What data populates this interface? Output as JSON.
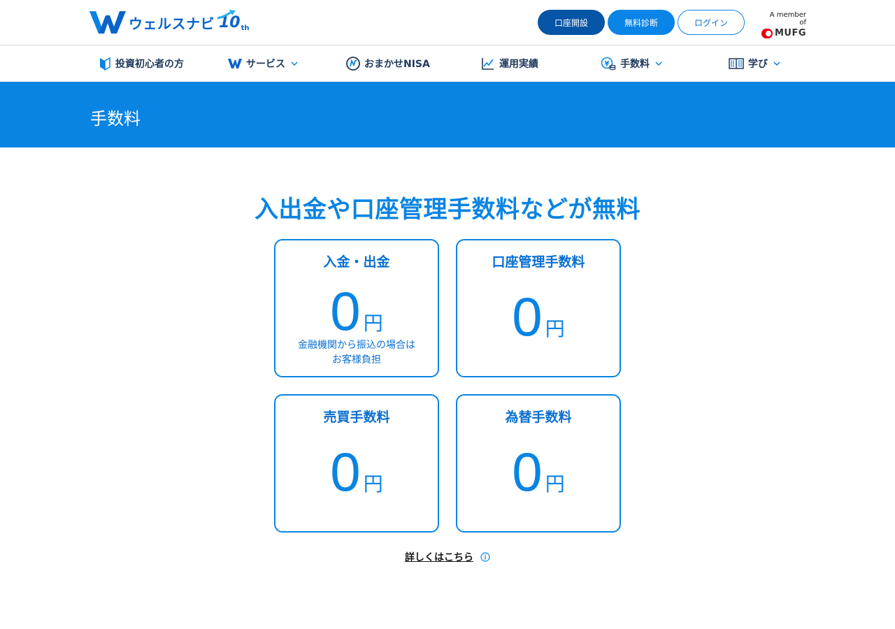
{
  "header": {
    "logo_text": "ウェルスナビ",
    "logo_anniv": "10",
    "logo_anniv_suffix": "th",
    "buttons": {
      "open_account": "口座開設",
      "free_diagnosis": "無料診断",
      "login": "ログイン"
    },
    "mufg": {
      "member_text": "A member of",
      "name": "MUFG"
    }
  },
  "nav": {
    "items": [
      {
        "label": "投資初心者の方",
        "icon": "beginner-mark-icon"
      },
      {
        "label": "サービス",
        "icon": "w-logo-icon",
        "dropdown": true
      },
      {
        "label": "おまかせNISA",
        "icon": "nisa-icon"
      },
      {
        "label": "運用実績",
        "icon": "chart-icon"
      },
      {
        "label": "手数料",
        "icon": "yen-coins-icon",
        "dropdown": true
      },
      {
        "label": "学び",
        "icon": "book-icon",
        "dropdown": true
      }
    ]
  },
  "page": {
    "title": "手数料",
    "headline": "入出金や口座管理手数料などが無料"
  },
  "cards": [
    {
      "title": "入金・出金",
      "value": "0",
      "unit": "円",
      "note_line1": "金融機関から振込の場合は",
      "note_line2": "お客様負担"
    },
    {
      "title": "口座管理手数料",
      "value": "0",
      "unit": "円"
    },
    {
      "title": "売買手数料",
      "value": "0",
      "unit": "円"
    },
    {
      "title": "為替手数料",
      "value": "0",
      "unit": "円"
    }
  ],
  "details_link": "詳しくはこちら",
  "colors": {
    "primary": "#0a84e2",
    "dark_blue": "#0655a6",
    "nav_text": "#1f3a5c",
    "mufg_red": "#e60012"
  }
}
